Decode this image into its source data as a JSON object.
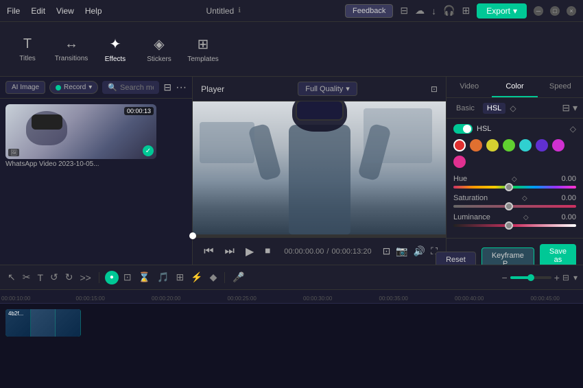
{
  "app": {
    "title": "Untitled",
    "feedback_label": "Feedback",
    "export_label": "Export"
  },
  "menubar": {
    "items": [
      "File",
      "Edit",
      "View",
      "Help"
    ]
  },
  "toolbar": {
    "items": [
      {
        "id": "titles",
        "label": "Titles",
        "icon": "T"
      },
      {
        "id": "transitions",
        "label": "Transitions",
        "icon": "↔"
      },
      {
        "id": "effects",
        "label": "Effects",
        "icon": "✦"
      },
      {
        "id": "stickers",
        "label": "Stickers",
        "icon": "◈"
      },
      {
        "id": "templates",
        "label": "Templates",
        "icon": "⊞"
      }
    ]
  },
  "left_panel": {
    "ai_image_label": "AI Image",
    "record_label": "Record",
    "search_placeholder": "Search media",
    "media_items": [
      {
        "name": "WhatsApp Video 2023-10-05...",
        "duration": "00:00:13",
        "has_check": true
      }
    ]
  },
  "player": {
    "label": "Player",
    "quality": "Full Quality",
    "current_time": "00:00:00.00",
    "total_time": "00:00:13:20",
    "progress": 0
  },
  "right_panel": {
    "tabs": [
      "Video",
      "Color",
      "Speed"
    ],
    "active_tab": "Color",
    "sub_tabs": [
      "Basic",
      "HSL"
    ],
    "active_sub_tab": "HSL",
    "hsl": {
      "enabled": true,
      "label": "HSL",
      "colors": [
        {
          "color": "#e03030",
          "selected": true
        },
        {
          "color": "#e07030"
        },
        {
          "color": "#d4d030"
        },
        {
          "color": "#60d030"
        },
        {
          "color": "#30d0d0"
        },
        {
          "color": "#6030d0"
        },
        {
          "color": "#d030d0"
        },
        {
          "color": "#e03090"
        }
      ],
      "sliders": [
        {
          "name": "Hue",
          "value": "0.00",
          "position": 45
        },
        {
          "name": "Saturation",
          "value": "0.00",
          "position": 45
        },
        {
          "name": "Luminance",
          "value": "0.00",
          "position": 45
        }
      ]
    }
  },
  "timeline": {
    "ruler_times": [
      "00:00:10:00",
      "00:00:15:00",
      "00:00:20:00",
      "00:00:25:00",
      "00:00:30:00",
      "00:00:35:00",
      "00:00:40:00",
      "00:00:45:00"
    ],
    "clip_label": "4b2f..."
  },
  "bottom_actions": {
    "reset_label": "Reset",
    "keyframe_label": "Keyframe P...",
    "save_label": "Save as cu..."
  }
}
